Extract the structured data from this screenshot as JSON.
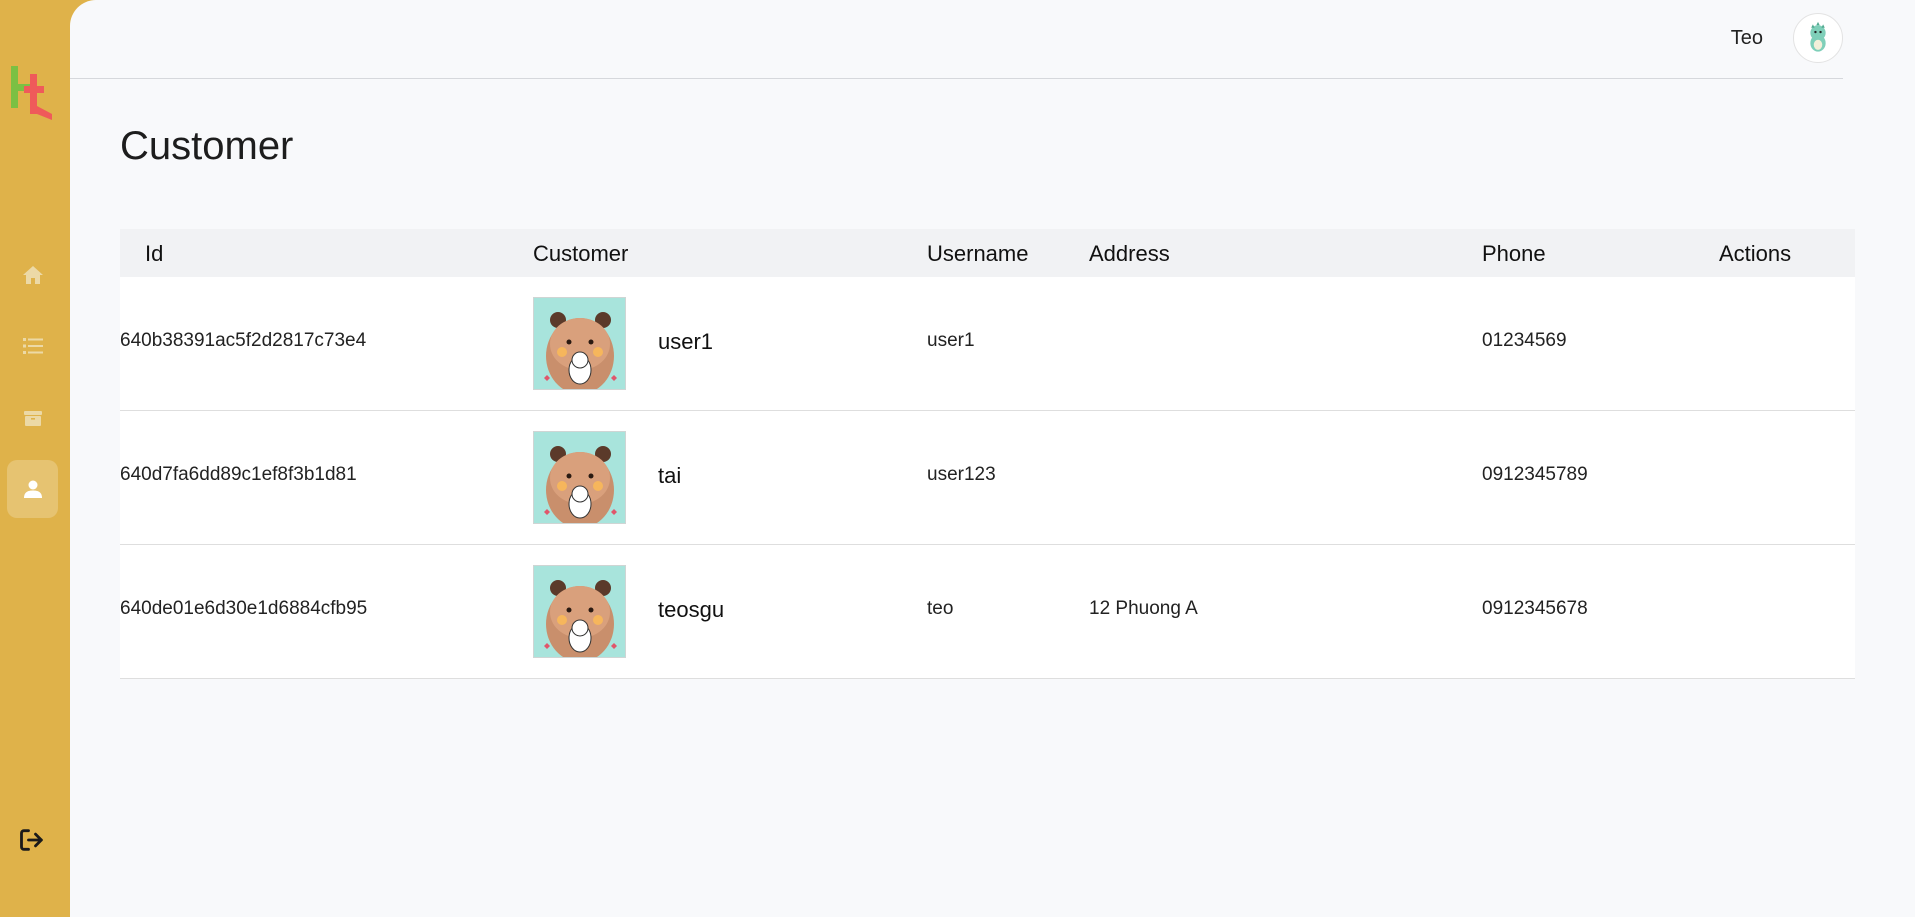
{
  "sidebar": {
    "logo_icon": "ht-logo-icon",
    "items": [
      {
        "name": "home",
        "icon": "home-icon"
      },
      {
        "name": "list",
        "icon": "list-icon"
      },
      {
        "name": "products",
        "icon": "box-icon"
      },
      {
        "name": "customers",
        "icon": "user-icon",
        "active": true
      }
    ],
    "logout_icon": "logout-icon"
  },
  "header": {
    "user_name": "Teo",
    "avatar_icon": "dino-avatar-icon"
  },
  "page": {
    "title": "Customer"
  },
  "table": {
    "columns": [
      "Id",
      "Customer",
      "Username",
      "Address",
      "Phone",
      "Actions"
    ],
    "rows": [
      {
        "id": "640b38391ac5f2d2817c73e4",
        "name": "user1",
        "username": "user1",
        "address": "",
        "phone": "01234569"
      },
      {
        "id": "640d7fa6dd89c1ef8f3b1d81",
        "name": "tai",
        "username": "user123",
        "address": "",
        "phone": "0912345789"
      },
      {
        "id": "640de01e6d30e1d6884cfb95",
        "name": "teosgu",
        "username": "teo",
        "address": "12 Phuong A",
        "phone": "0912345678"
      }
    ]
  },
  "colors": {
    "sidebar": "#dfb24a",
    "background": "#f8f9fb",
    "header_row": "#f1f2f4"
  }
}
